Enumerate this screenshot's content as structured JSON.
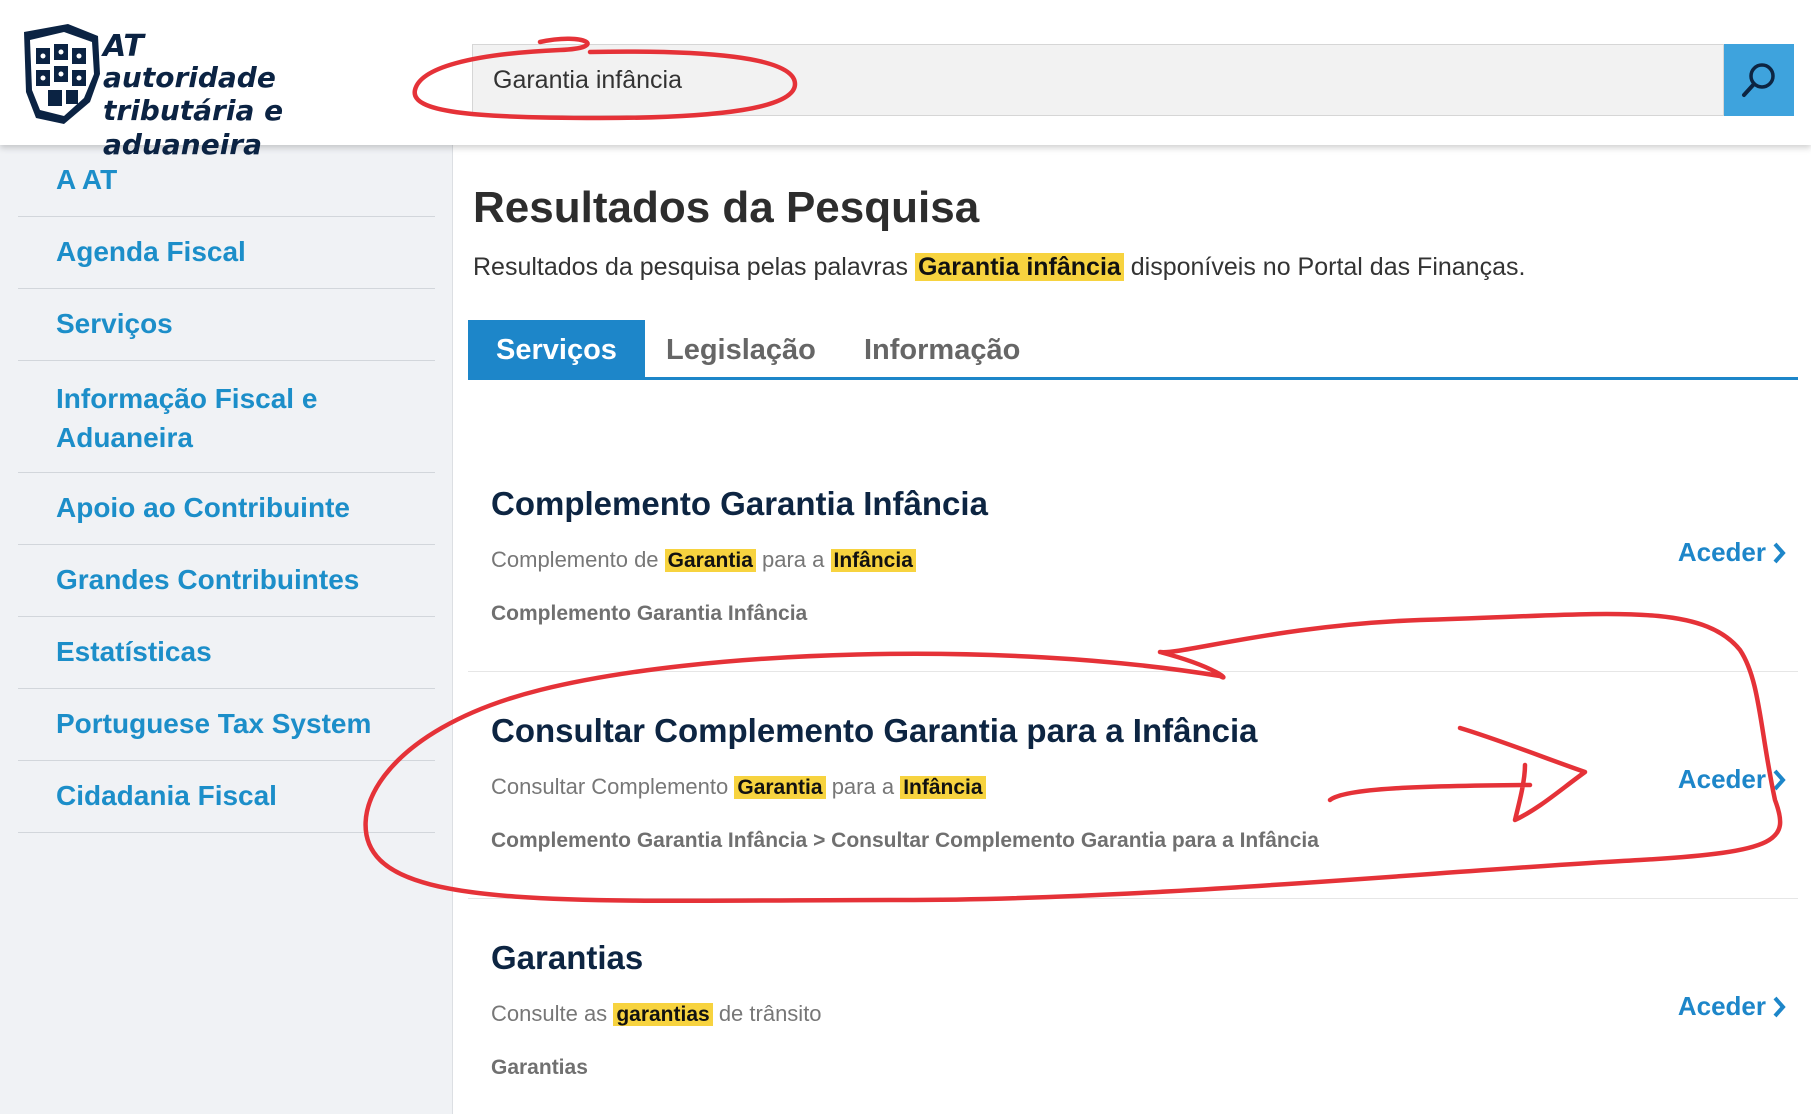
{
  "header": {
    "logo": {
      "abbr": "AT",
      "line1": "autoridade",
      "line2": "tributária e aduaneira"
    },
    "search": {
      "value": "Garantia infância",
      "button_icon": "search-icon"
    }
  },
  "sidebar": {
    "items": [
      {
        "label": "A AT"
      },
      {
        "label": "Agenda Fiscal"
      },
      {
        "label": "Serviços"
      },
      {
        "label_line1": "Informação Fiscal e",
        "label_line2": "Aduaneira"
      },
      {
        "label": "Apoio ao Contribuinte"
      },
      {
        "label": "Grandes Contribuintes"
      },
      {
        "label": "Estatísticas"
      },
      {
        "label": "Portuguese Tax System"
      },
      {
        "label": "Cidadania Fiscal"
      }
    ]
  },
  "main": {
    "title": "Resultados da Pesquisa",
    "subtitle_before": "Resultados da pesquisa pelas palavras",
    "subtitle_keywords": "Garantia infância",
    "subtitle_after": "disponíveis no Portal das Finanças.",
    "tabs": [
      {
        "label": "Serviços",
        "active": true
      },
      {
        "label": "Legislação",
        "active": false
      },
      {
        "label": "Informação",
        "active": false
      }
    ],
    "results": [
      {
        "title": "Complemento Garantia Infância",
        "desc_1": "Complemento de",
        "desc_hl_1": "Garantia",
        "desc_2": "para a",
        "desc_hl_2": "Infância",
        "path": "Complemento Garantia Infância",
        "action": "Aceder"
      },
      {
        "title": "Consultar Complemento Garantia para a Infância",
        "desc_1": "Consultar Complemento",
        "desc_hl_1": "Garantia",
        "desc_2": "para a",
        "desc_hl_2": "Infância",
        "path": "Complemento Garantia Infância > Consultar Complemento Garantia para a Infância",
        "action": "Aceder"
      },
      {
        "title": "Garantias",
        "desc_1": "Consulte as",
        "desc_hl_1": "garantias",
        "desc_2": "de trânsito",
        "path": "Garantias",
        "action": "Aceder"
      }
    ]
  },
  "colors": {
    "brand_blue": "#1d86c9",
    "search_button": "#3ea3dd",
    "highlight": "#f7d33f",
    "annotation_red": "#e53238"
  }
}
